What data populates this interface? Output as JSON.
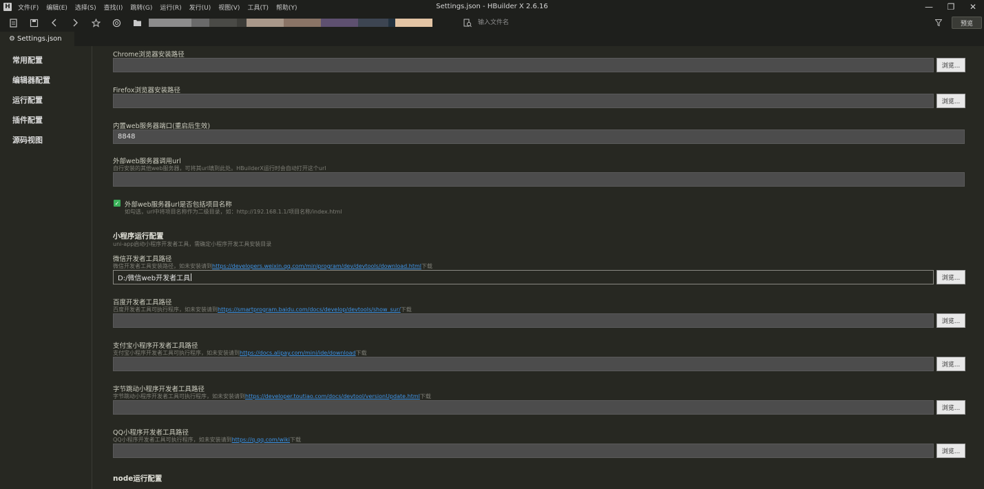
{
  "window": {
    "title": "Settings.json - HBuilder X 2.6.16",
    "logo": "H",
    "minimize": "—",
    "maximize": "❐",
    "close": "✕"
  },
  "menu": [
    "文件(F)",
    "编辑(E)",
    "选择(S)",
    "查找(I)",
    "跳转(G)",
    "运行(R)",
    "发行(U)",
    "视图(V)",
    "工具(T)",
    "帮助(Y)"
  ],
  "toolbar": {
    "icons": [
      "new-file-icon",
      "save-icon",
      "back-icon",
      "forward-icon",
      "star-icon",
      "browser-icon",
      "folder-icon"
    ],
    "path_colors": [
      "#8c8c8c",
      "#6a6a6a",
      "#4a4a46",
      "#3c3c38",
      "#a9988a",
      "#8a7466",
      "#5e5070",
      "#3d4552",
      "#23323f",
      "#e3c4a4"
    ],
    "file_search_placeholder": "输入文件名",
    "preview_label": "预览"
  },
  "tab": {
    "label": "Settings.json"
  },
  "sidebar": {
    "items": [
      "常用配置",
      "编辑器配置",
      "运行配置",
      "插件配置",
      "源码视图"
    ]
  },
  "settings": {
    "chrome_label": "Chrome浏览器安装路径",
    "chrome_value": "",
    "firefox_label": "Firefox浏览器安装路径",
    "firefox_value": "",
    "port_label": "内置web服务器端口(重启后生效)",
    "port_value": "8848",
    "ext_url_label": "外部web服务器调用url",
    "ext_url_desc": "自行安装的其他web服务器，可将其url填到此处。HBuilderX运行时会自动打开这个url",
    "ext_url_value": "",
    "include_project_label": "外部web服务器url是否包括项目名称",
    "include_project_desc": "如勾选，url中将项目名称作为二级目录，如：http://192.168.1.1/项目名称/index.html",
    "mp_section_title": "小程序运行配置",
    "mp_section_desc": "uni-app启动小程序开发者工具，需确定小程序开发工具安装目录",
    "wechat_label": "微信开发者工具路径",
    "wechat_desc_pre": "微信开发者工具安装路径，如未安装请到",
    "wechat_link": "https://developers.weixin.qq.com/miniprogram/dev/devtools/download.html",
    "wechat_desc_post": "下载",
    "wechat_value": "D:/微信web开发者工具",
    "baidu_label": "百度开发者工具路径",
    "baidu_desc_pre": "百度开发者工具可执行程序，如未安装请到",
    "baidu_link": "https://smartprogram.baidu.com/docs/develop/devtools/show_sur/",
    "baidu_desc_post": "下载",
    "alipay_label": "支付宝小程序开发者工具路径",
    "alipay_desc_pre": "支付宝小程序开发者工具可执行程序，如未安装请到",
    "alipay_link": "https://docs.alipay.com/mini/ide/download",
    "alipay_desc_post": "下载",
    "toutiao_label": "字节跳动小程序开发者工具路径",
    "toutiao_desc_pre": "字节跳动小程序开发者工具可执行程序，如未安装请到",
    "toutiao_link": "https://developer.toutiao.com/docs/devtool/versionUpdate.html",
    "toutiao_desc_post": "下载",
    "qq_label": "QQ小程序开发者工具路径",
    "qq_desc_pre": "QQ小程序开发者工具可执行程序，如未安装请到",
    "qq_link": "https://q.qq.com/wiki",
    "qq_desc_post": "下载",
    "node_section_title": "node运行配置",
    "browse_label": "浏览..."
  }
}
